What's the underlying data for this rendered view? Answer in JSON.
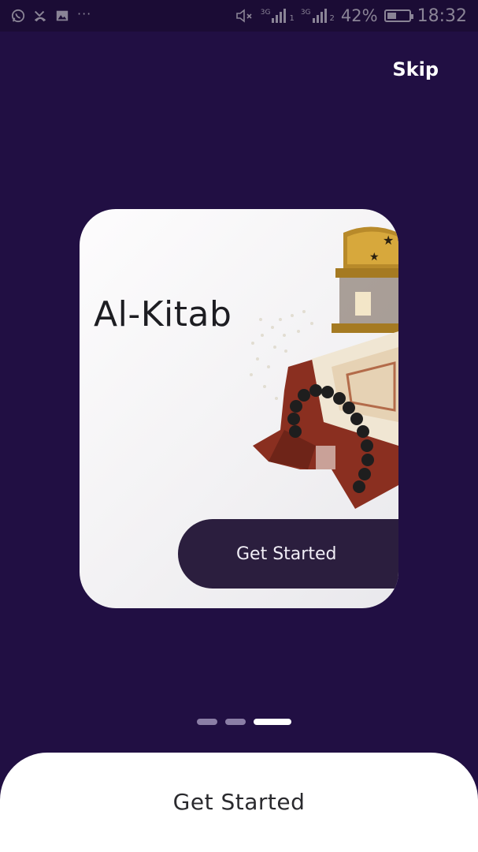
{
  "status_bar": {
    "battery_percent": "42%",
    "time": "18:32",
    "signal_label_1": "3G",
    "signal_label_2": "3G",
    "sim_1": "1",
    "sim_2": "2",
    "more": "···",
    "icons": [
      "whatsapp-icon",
      "missed-call-icon",
      "image-icon",
      "mute-icon",
      "signal-icon",
      "battery-icon"
    ],
    "battery_level": 0.42
  },
  "header": {
    "skip_label": "Skip"
  },
  "card": {
    "title": "Al-Kitab",
    "button_label": "Get Started"
  },
  "pager": {
    "count": 3,
    "active_index": 2
  },
  "bottom": {
    "button_label": "Get Started"
  },
  "colors": {
    "background": "#210f43",
    "card_button": "#2b1e3e",
    "dot_inactive": "#8b7ea6",
    "dot_active": "#ffffff"
  }
}
